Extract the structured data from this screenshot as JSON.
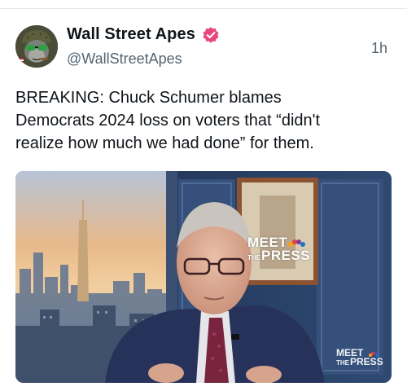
{
  "post": {
    "author": {
      "display_name": "Wall Street Apes",
      "handle": "@WallStreetApes",
      "verified": true,
      "verified_color": "#e8467c",
      "avatar_icon": "ape-avatar-icon"
    },
    "timestamp": "1h",
    "text": "BREAKING: Chuck Schumer blames\nDemocrats 2024 loss on voters that “didn't\nrealize how much we had done” for them.",
    "media": {
      "type": "video-still",
      "watermark_main": {
        "line1": "MEET",
        "line2_small": "THE",
        "line2": "PRESS"
      },
      "watermark_corner": {
        "line1": "MEET",
        "line2_small": "THE",
        "line2": "PRESS"
      }
    }
  },
  "colors": {
    "text_primary": "#0f1419",
    "text_secondary": "#536471",
    "divider": "#e6e6e6"
  }
}
